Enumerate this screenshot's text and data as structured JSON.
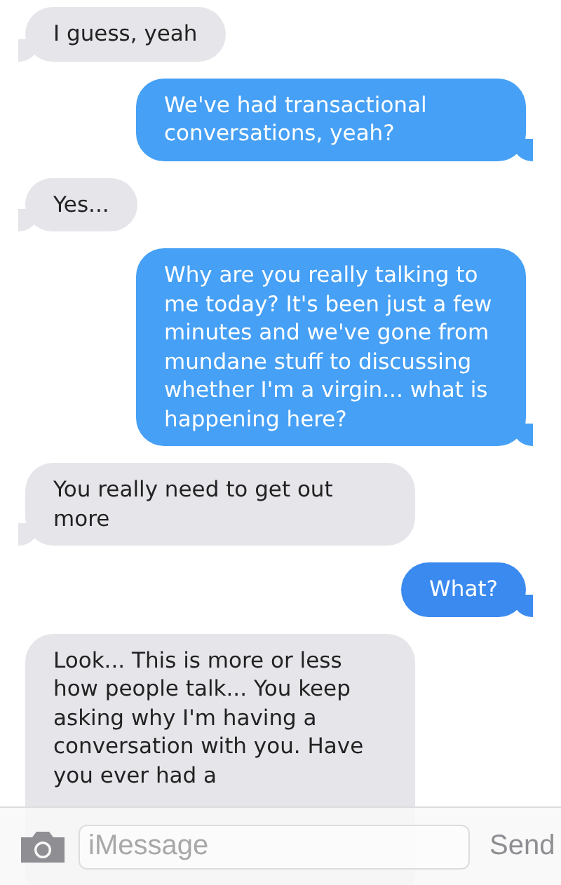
{
  "messages": [
    {
      "kind": "incoming",
      "text": "I guess, yeah"
    },
    {
      "kind": "outgoing",
      "text": "We've had transactional conversations, yeah?"
    },
    {
      "kind": "incoming",
      "text": "Yes..."
    },
    {
      "kind": "outgoing",
      "text": "Why are you really talking to me today? It's been just a few minutes and we've gone from mundane stuff to discussing whether I'm a virgin... what is happening here?"
    },
    {
      "kind": "incoming",
      "text": "You really need to get out more"
    },
    {
      "kind": "outgoing",
      "text": "What?"
    },
    {
      "kind": "incoming",
      "text": "Look... This is more or less how people talk... You keep asking why I'm having a conversation with you. Have you ever had a"
    }
  ],
  "composer": {
    "placeholder": "iMessage",
    "send": "Send"
  }
}
